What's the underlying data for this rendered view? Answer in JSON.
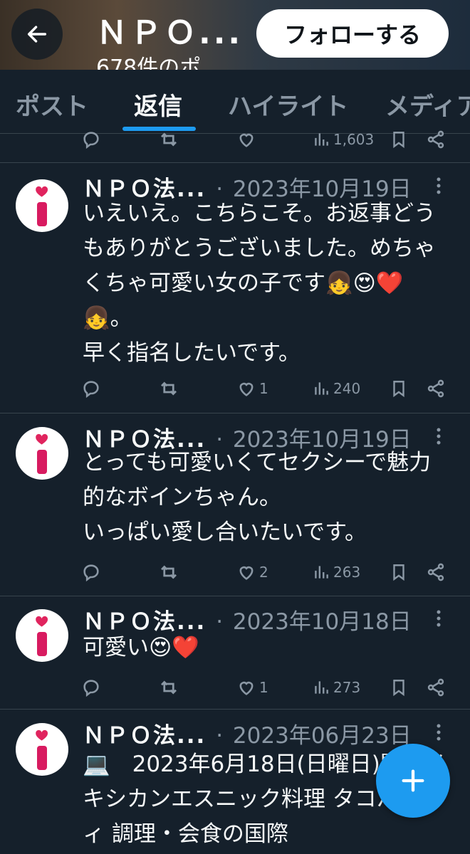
{
  "header": {
    "title": "ＮＰＯ...",
    "post_count": "678件のポ",
    "follow_label": "フォローする",
    "background_color": "#3a3026"
  },
  "tabs": [
    {
      "label": "ポスト",
      "active": false
    },
    {
      "label": "返信",
      "active": true
    },
    {
      "label": "ハイライト",
      "active": false
    },
    {
      "label": "メディア",
      "active": false
    }
  ],
  "colors": {
    "background": "#15202b",
    "accent": "#1d9bf0",
    "muted": "#8b98a5",
    "heart": "#e0245e"
  },
  "partial_tweet": {
    "views": "1,603"
  },
  "tweets": [
    {
      "name": "ＮＰＯ法...",
      "separator": "·",
      "date": "2023年10月19日",
      "text": "いえいえ。こちらこそ。お返事どうもありがとうございました。めちゃくちゃ可愛い女の子です👧😍❤️👧。\n早く指名したいです。",
      "likes": "1",
      "views": "240"
    },
    {
      "name": "ＮＰＯ法...",
      "separator": "·",
      "date": "2023年10月19日",
      "text": "とっても可愛いくてセクシーで魅力的なボインちゃん。\nいっぱい愛し合いたいです。",
      "likes": "2",
      "views": "263"
    },
    {
      "name": "ＮＰＯ法...",
      "separator": "·",
      "date": "2023年10月18日",
      "text": "可愛い😍❤️",
      "likes": "1",
      "views": "273"
    },
    {
      "name": "ＮＰＯ法...",
      "separator": "·",
      "date": "2023年06月23日",
      "text": "💻　2023年6月18日(日曜日)開催メキシカンエスニック料理 タコパーティ 調理・会食の国際",
      "likes": "",
      "views": ""
    }
  ],
  "fab": {
    "icon": "plus-icon"
  }
}
